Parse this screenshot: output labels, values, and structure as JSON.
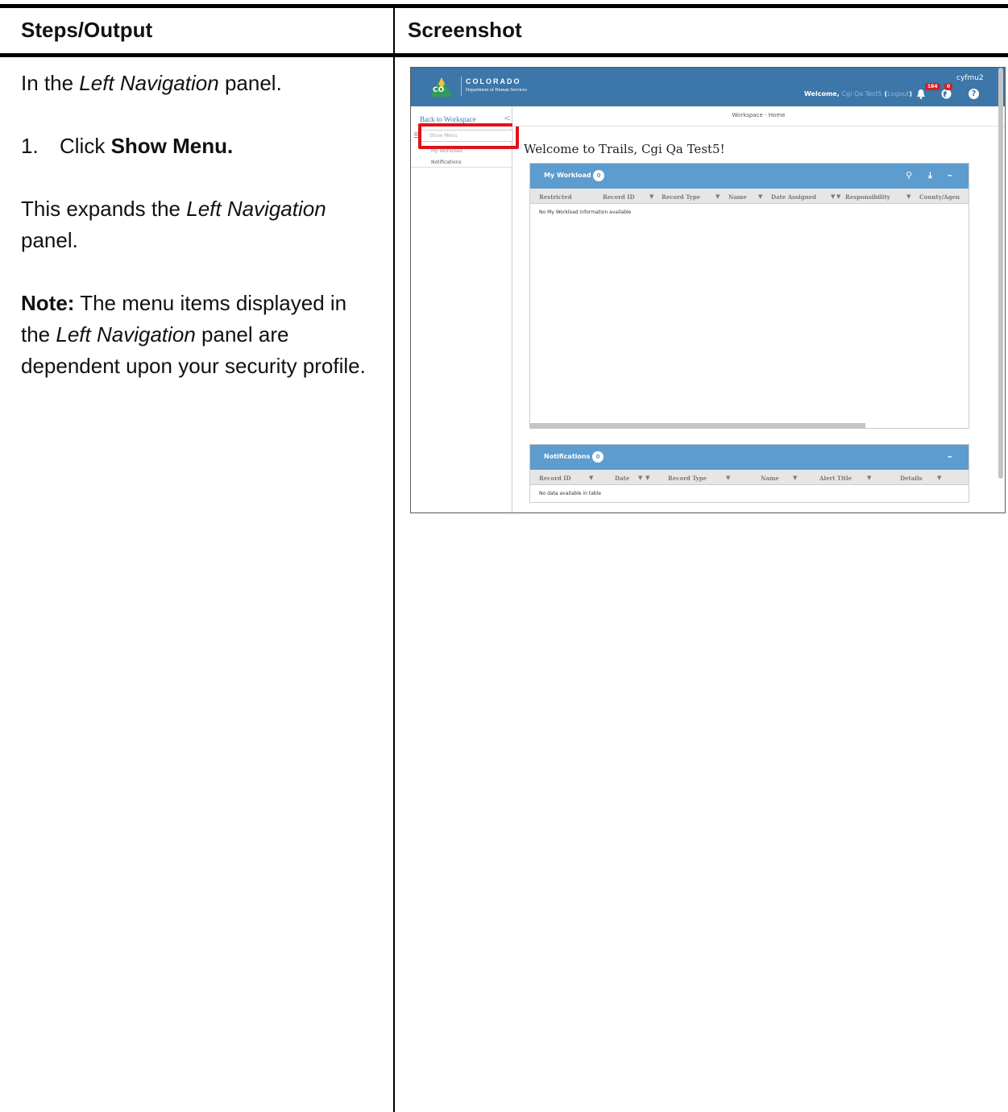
{
  "doc": {
    "header_left": "Steps/Output",
    "header_right": "Screenshot",
    "intro_prefix": "In the ",
    "intro_em": "Left Navigation",
    "intro_suffix": " panel.",
    "step_number": "1.",
    "step_prefix": "Click ",
    "step_bold": "Show Menu.",
    "expand_prefix": "This expands the ",
    "expand_em": "Left Navigation",
    "expand_suffix": " panel.",
    "note_label": "Note:",
    "note_prefix": "  The menu items displayed in the ",
    "note_em": "Left Navigation",
    "note_suffix": " panel are dependent upon your security profile."
  },
  "app": {
    "logo_badge": "CO",
    "logo_title": "COLORADO",
    "logo_subtitle": "Department of Human Services",
    "welcome_label": "Welcome,",
    "welcome_user": "Cgi Qa Test5",
    "logout_open": "(",
    "logout_label": "Logout",
    "logout_close": ")",
    "username": "cyfmu2",
    "alerts_count": "184",
    "globe_count": "0",
    "help_glyph": "?",
    "nav": {
      "back_label": "Back to Workspace",
      "back_chevron": "<",
      "menu_glyph": "☰",
      "show_menu_placeholder": "Show Menu",
      "my_workload": "My Workload",
      "notifications": "Notifications"
    },
    "breadcrumb": "Workspace - Home",
    "page_title": "Welcome to Trails, Cgi Qa Test5!",
    "workload": {
      "title": "My Workload",
      "count": "0",
      "search_glyph": "⚲",
      "download_glyph": "⤓",
      "collapse_glyph": "–",
      "columns": [
        "Restricted",
        "Record ID",
        "Record Type",
        "Name",
        "Date Assigned",
        "Responsibility",
        "County/Agen"
      ],
      "filter_glyph": "▼",
      "sort_glyph": "▼",
      "empty_message": "No My Workload  information available"
    },
    "notifications": {
      "title": "Notifications",
      "count": "0",
      "collapse_glyph": "–",
      "columns": [
        "Record ID",
        "Date",
        "Record Type",
        "Name",
        "Alert Title",
        "Details"
      ],
      "filter_glyph": "▼",
      "sort_glyph": "▼",
      "empty_message": "No data available in table"
    },
    "colors": {
      "header_blue": "#3d76a8",
      "panel_blue": "#5d9ccf",
      "highlight_red": "#e3101a",
      "badge_red": "#d61f26"
    }
  }
}
